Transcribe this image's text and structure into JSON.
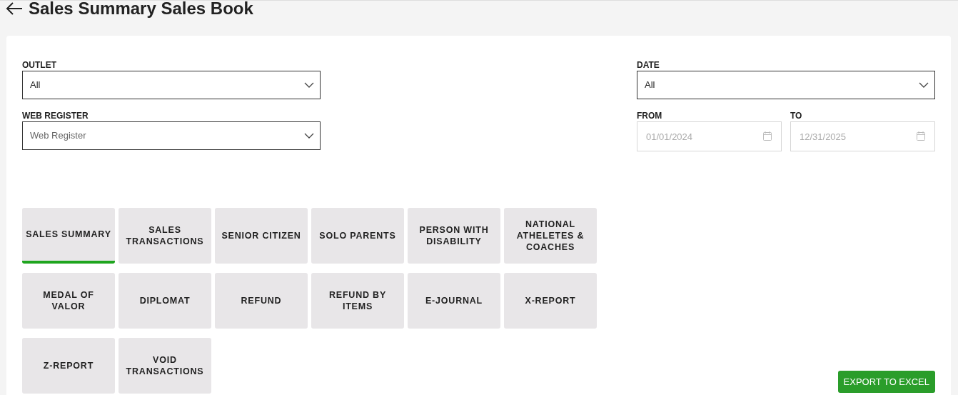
{
  "header": {
    "title": "Sales Summary Sales Book"
  },
  "filters": {
    "outlet": {
      "label": "OUTLET",
      "value": "All"
    },
    "web_register": {
      "label": "WEB REGISTER",
      "placeholder": "Web Register"
    },
    "date": {
      "label": "DATE",
      "value": "All"
    },
    "from": {
      "label": "FROM",
      "value": "01/01/2024",
      "disabled": true
    },
    "to": {
      "label": "TO",
      "value": "12/31/2025",
      "disabled": true
    }
  },
  "report_tabs": [
    {
      "label": "SALES SUMMARY",
      "selected": true
    },
    {
      "label": "SALES TRANSACTIONS",
      "selected": false
    },
    {
      "label": "SENIOR CITIZEN",
      "selected": false
    },
    {
      "label": "SOLO PARENTS",
      "selected": false
    },
    {
      "label": "PERSON WITH DISABILITY",
      "selected": false
    },
    {
      "label": "NATIONAL ATHELETES & COACHES",
      "selected": false
    },
    {
      "label": "MEDAL OF VALOR",
      "selected": false
    },
    {
      "label": "DIPLOMAT",
      "selected": false
    },
    {
      "label": "REFUND",
      "selected": false
    },
    {
      "label": "REFUND BY ITEMS",
      "selected": false
    },
    {
      "label": "E-JOURNAL",
      "selected": false
    },
    {
      "label": "X-REPORT",
      "selected": false
    },
    {
      "label": "Z-REPORT",
      "selected": false
    },
    {
      "label": "VOID TRANSACTIONS",
      "selected": false
    }
  ],
  "export_button": {
    "label": "EXPORT TO EXCEL"
  }
}
